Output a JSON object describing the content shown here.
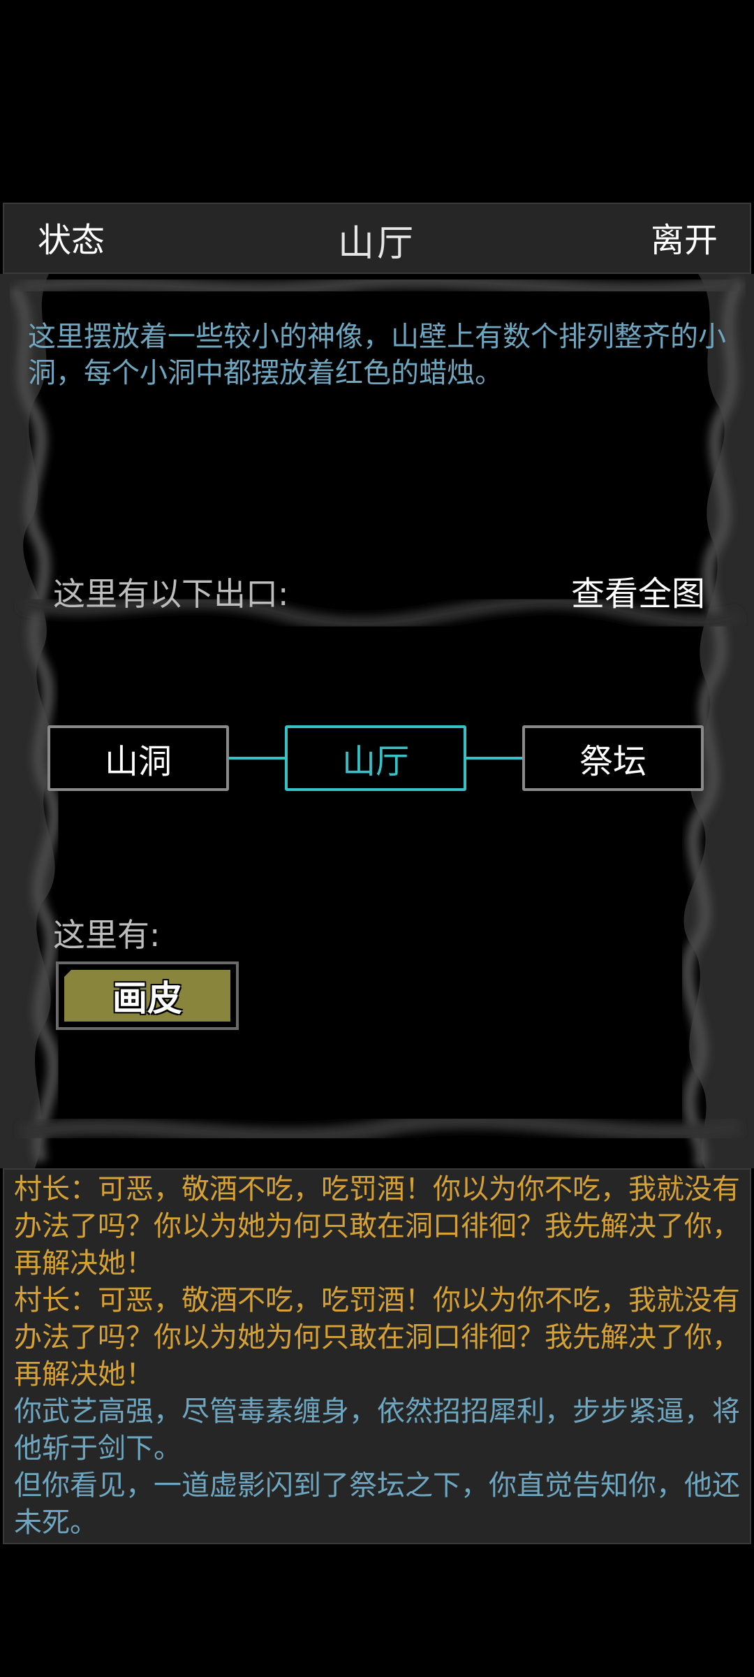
{
  "header": {
    "left_button": "状态",
    "title": "山厅",
    "right_button": "离开"
  },
  "room": {
    "description": "这里摆放着一些较小的神像，山壁上有数个排列整齐的小洞，每个小洞中都摆放着红色的蜡烛。",
    "exits_label": "这里有以下出口:",
    "view_map_label": "查看全图",
    "map": {
      "left_room": "山洞",
      "current_room": "山厅",
      "right_room": "祭坛"
    },
    "here_label": "这里有:",
    "items": [
      "画皮"
    ]
  },
  "log": [
    {
      "text": "村长：可恶，敬酒不吃，吃罚酒！你以为你不吃，我就没有办法了吗？你以为她为何只敢在洞口徘徊？我先解决了你，再解决她！",
      "color": "yellow"
    },
    {
      "text": "村长：可恶，敬酒不吃，吃罚酒！你以为你不吃，我就没有办法了吗？你以为她为何只敢在洞口徘徊？我先解决了你，再解决她！",
      "color": "yellow"
    },
    {
      "text": "你武艺高强，尽管毒素缠身，依然招招犀利，步步紧逼，将他斩于剑下。",
      "color": "blue"
    },
    {
      "text": "但你看见，一道虚影闪到了祭坛之下，你直觉告知你，他还未死。",
      "color": "blue"
    }
  ],
  "colors": {
    "accent": "#35c3c8",
    "description_text": "#6fa6c0",
    "log_yellow": "#d6a235",
    "item_button": "#8a853c"
  }
}
